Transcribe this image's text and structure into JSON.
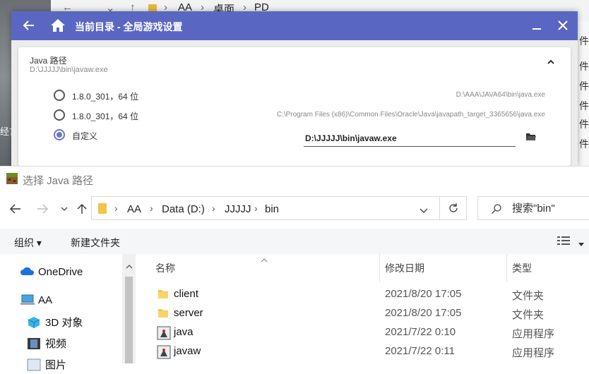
{
  "background_explorer": {
    "crumbs": [
      "AA",
      "桌面",
      "PD"
    ],
    "side_labels": [
      "件夹",
      "件夹",
      "件夹",
      "件夹",
      "件夹",
      "件夹"
    ],
    "left_label": "经言"
  },
  "launcher": {
    "title": "当前目录 - 全局游戏设置",
    "accent_color": "#5a67c2",
    "java_card": {
      "title": "Java 路径",
      "current_path": "D:\\JJJJJ\\bin\\javaw.exe",
      "options": [
        {
          "label": "1.8.0_301，64 位",
          "path": "D:\\AAA\\JAVA64\\bin\\java.exe",
          "selected": false
        },
        {
          "label": "1.8.0_301，64 位",
          "path": "C:\\Program Files (x86)\\Common Files\\Oracle\\Java\\javapath_target_3365656\\java.exe",
          "selected": false
        },
        {
          "label": "自定义",
          "selected": true
        }
      ],
      "custom_value": "D:\\JJJJJ\\bin\\javaw.exe"
    }
  },
  "dialog": {
    "title": "选择 Java 路径",
    "address": {
      "crumbs": [
        "AA",
        "Data (D:)",
        "JJJJJ",
        "bin"
      ]
    },
    "search_placeholder": "搜索\"bin\"",
    "toolbar": {
      "organize": "组织 ▾",
      "new_folder": "新建文件夹"
    },
    "nav_items": [
      {
        "label": "OneDrive",
        "icon": "cloud-icon"
      },
      {
        "label": "AA",
        "icon": "computer-icon"
      },
      {
        "label": "3D 对象",
        "icon": "cube-icon"
      },
      {
        "label": "视频",
        "icon": "film-icon"
      },
      {
        "label": "图片",
        "icon": "picture-icon"
      }
    ],
    "columns": {
      "name": "名称",
      "date": "修改日期",
      "type": "类型"
    },
    "files": [
      {
        "name": "client",
        "date": "2021/8/20 17:05",
        "type": "文件夹",
        "icon": "folder-icon"
      },
      {
        "name": "server",
        "date": "2021/8/20 17:05",
        "type": "文件夹",
        "icon": "folder-icon"
      },
      {
        "name": "java",
        "date": "2021/7/22 0:10",
        "type": "应用程序",
        "icon": "java-app-icon"
      },
      {
        "name": "javaw",
        "date": "2021/7/22 0:11",
        "type": "应用程序",
        "icon": "java-app-icon"
      }
    ]
  }
}
